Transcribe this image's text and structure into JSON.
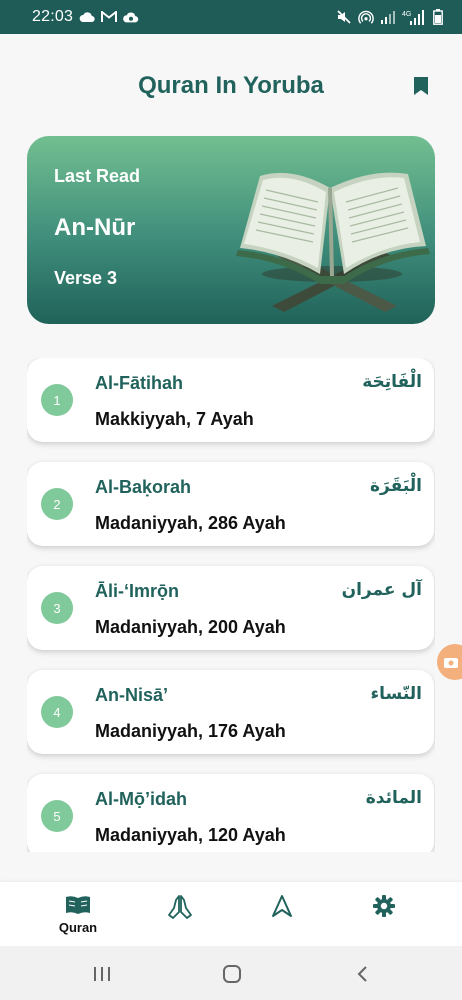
{
  "status_bar": {
    "time": "22:03",
    "left_icons": [
      "cloud-icon",
      "gmail-icon",
      "cloud-sync-icon"
    ],
    "right_icons": [
      "mute-icon",
      "hotspot-icon",
      "signal-icon",
      "lte-signal-icon",
      "battery-icon"
    ],
    "network_label": "4G"
  },
  "header": {
    "title": "Quran In Yoruba",
    "bookmark_icon": "bookmark-icon"
  },
  "last_read": {
    "label": "Last Read",
    "surah": "An-Nūr",
    "verse": "Verse 3"
  },
  "surahs": [
    {
      "number": "1",
      "name": "Al-Fātihah",
      "arabic": "الْفَاتِحَة",
      "info": "Makkiyyah, 7 Ayah"
    },
    {
      "number": "2",
      "name": "Al-Baḳorah",
      "arabic": "الْبَقَرَة",
      "info": "Madaniyyah, 286 Ayah"
    },
    {
      "number": "3",
      "name": "Āli-‘Imrọ̄n",
      "arabic": "آل عمران",
      "info": "Madaniyyah, 200 Ayah"
    },
    {
      "number": "4",
      "name": "An-Nisā’",
      "arabic": "النّساء",
      "info": "Madaniyyah, 176 Ayah"
    },
    {
      "number": "5",
      "name": "Al-Mọ̄’idah",
      "arabic": "المائدة",
      "info": "Madaniyyah, 120 Ayah"
    }
  ],
  "bottom_nav": {
    "items": [
      {
        "label": "Quran",
        "icon": "open-book-icon",
        "active": true
      },
      {
        "label": "",
        "icon": "praying-hands-icon",
        "active": false
      },
      {
        "label": "",
        "icon": "navigation-arrow-icon",
        "active": false
      },
      {
        "label": "",
        "icon": "gear-icon",
        "active": false
      }
    ]
  },
  "system_nav": {
    "icons": [
      "recents-icon",
      "home-icon",
      "back-icon"
    ]
  },
  "colors": {
    "accent": "#21625c",
    "status_bar": "#1f5c58",
    "number_badge": "#80c99a",
    "card_gradient_top": "#72bf91",
    "card_gradient_bottom": "#206259",
    "edge_button": "#f3b07c"
  }
}
